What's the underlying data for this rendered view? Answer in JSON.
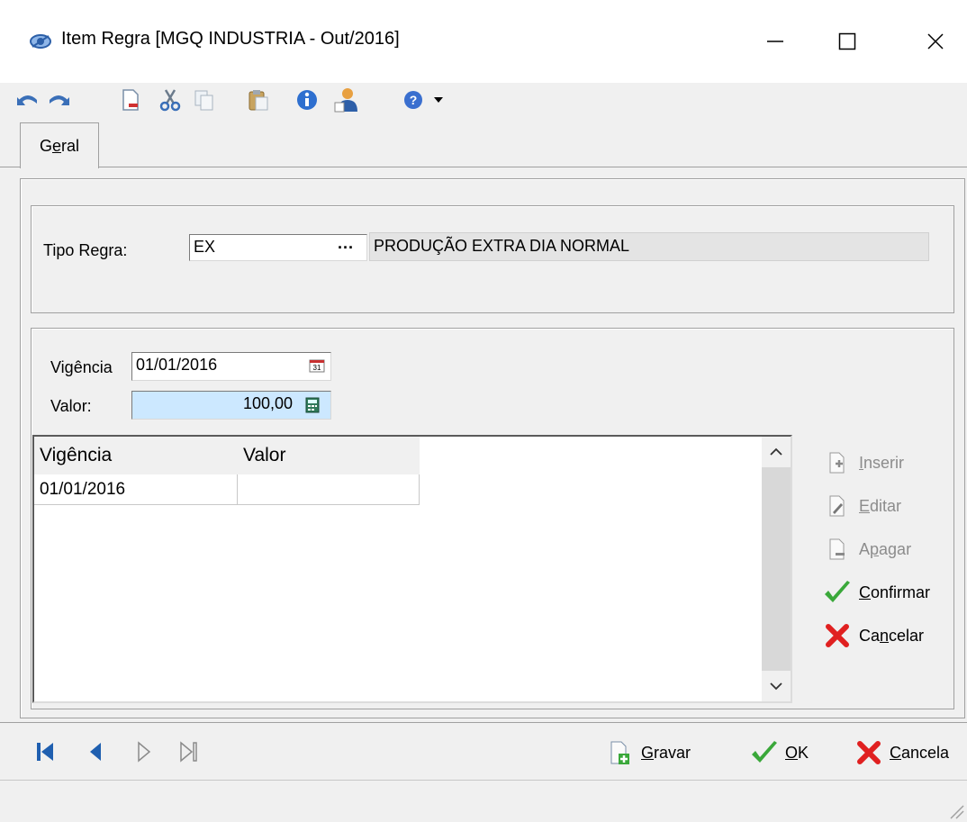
{
  "window": {
    "title": "Item Regra [MGQ INDUSTRIA - Out/2016]",
    "controls": [
      "minimize",
      "maximize",
      "close"
    ]
  },
  "toolbar": {
    "icons": [
      "undo-icon",
      "redo-icon",
      "new-document-icon",
      "cut-icon",
      "copy-icon",
      "paste-icon",
      "info-icon",
      "user-icon",
      "help-icon",
      "dropdown-arrow-icon"
    ]
  },
  "tabs": [
    {
      "label": "Geral",
      "underline_letter": "e",
      "selected": true
    }
  ],
  "tipo_regra": {
    "label": "Tipo Regra:",
    "code": "EX",
    "lookup_button": "···",
    "description": "PRODUÇÃO EXTRA DIA NORMAL"
  },
  "vigencia": {
    "label": "Vigência",
    "value": "01/01/2016"
  },
  "valor": {
    "label": "Valor:",
    "value": "100,00",
    "highlight_color": "#cce8ff"
  },
  "grid": {
    "columns": [
      "Vigência",
      "Valor"
    ],
    "rows": [
      [
        "01/01/2016",
        ""
      ]
    ]
  },
  "side_buttons": {
    "inserir": {
      "pre": "",
      "u": "I",
      "post": "nserir",
      "enabled": false
    },
    "editar": {
      "pre": "",
      "u": "E",
      "post": "ditar",
      "enabled": false
    },
    "apagar": {
      "pre": "A",
      "u": "p",
      "post": "agar",
      "enabled": false
    },
    "confirmar": {
      "pre": "",
      "u": "C",
      "post": "onfirmar",
      "enabled": true
    },
    "cancelar": {
      "pre": "Ca",
      "u": "n",
      "post": "celar",
      "enabled": true
    }
  },
  "bottom_buttons": {
    "gravar": {
      "pre": "",
      "u": "G",
      "post": "ravar"
    },
    "ok": {
      "pre": "",
      "u": "O",
      "post": "K"
    },
    "cancela": {
      "pre": "",
      "u": "C",
      "post": "ancela"
    }
  },
  "colors": {
    "confirm_green": "#3aa83a",
    "cancel_red": "#e02020",
    "nav_blue": "#1f5fb0"
  }
}
